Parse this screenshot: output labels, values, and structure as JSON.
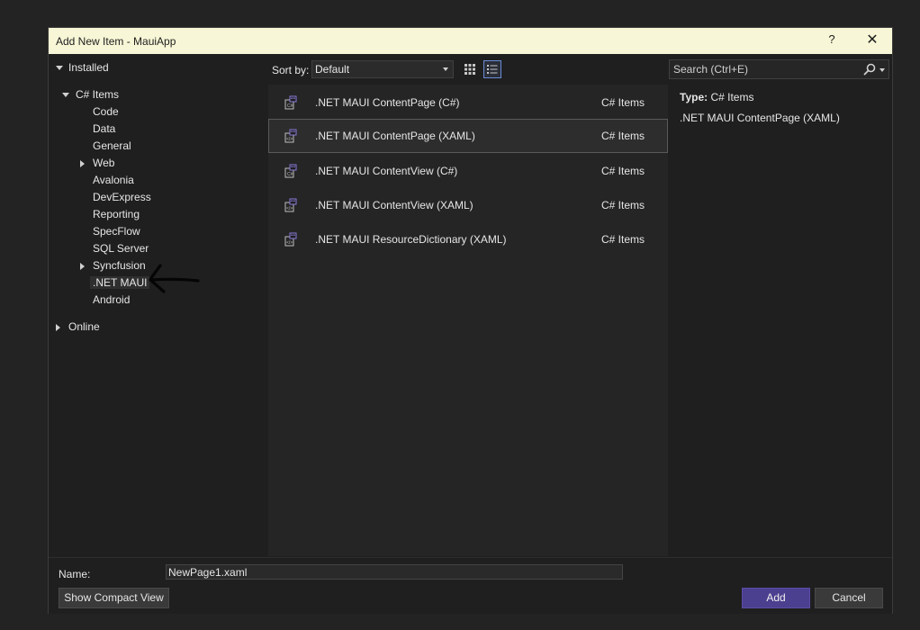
{
  "window": {
    "title": "Add New Item - MauiApp",
    "help": "?",
    "close": "✕"
  },
  "tree": {
    "installed": "Installed",
    "csharp_items": "C# Items",
    "children": [
      "Code",
      "Data",
      "General",
      "Web",
      "Avalonia",
      "DevExpress",
      "Reporting",
      "SpecFlow",
      "SQL Server",
      "Syncfusion",
      ".NET MAUI",
      "Android"
    ],
    "online": "Online"
  },
  "toolbar": {
    "sort_label": "Sort by:",
    "sort_value": "Default"
  },
  "templates": [
    {
      "name": ".NET MAUI ContentPage (C#)",
      "category": "C# Items"
    },
    {
      "name": ".NET MAUI ContentPage (XAML)",
      "category": "C# Items"
    },
    {
      "name": ".NET MAUI ContentView (C#)",
      "category": "C# Items"
    },
    {
      "name": ".NET MAUI ContentView (XAML)",
      "category": "C# Items"
    },
    {
      "name": ".NET MAUI ResourceDictionary (XAML)",
      "category": "C# Items"
    }
  ],
  "search": {
    "placeholder": "Search (Ctrl+E)"
  },
  "details": {
    "type_key": "Type:",
    "type_value": "C# Items",
    "description": ".NET MAUI ContentPage (XAML)"
  },
  "bottom": {
    "name_label": "Name:",
    "name_value": "NewPage1.xaml",
    "compact_button": "Show Compact View",
    "add_button": "Add",
    "cancel_button": "Cancel"
  },
  "colors": {
    "accent": "#4b3f8f",
    "titlebar": "#f7f6d6",
    "icon_purple": "#8a7bd8"
  }
}
